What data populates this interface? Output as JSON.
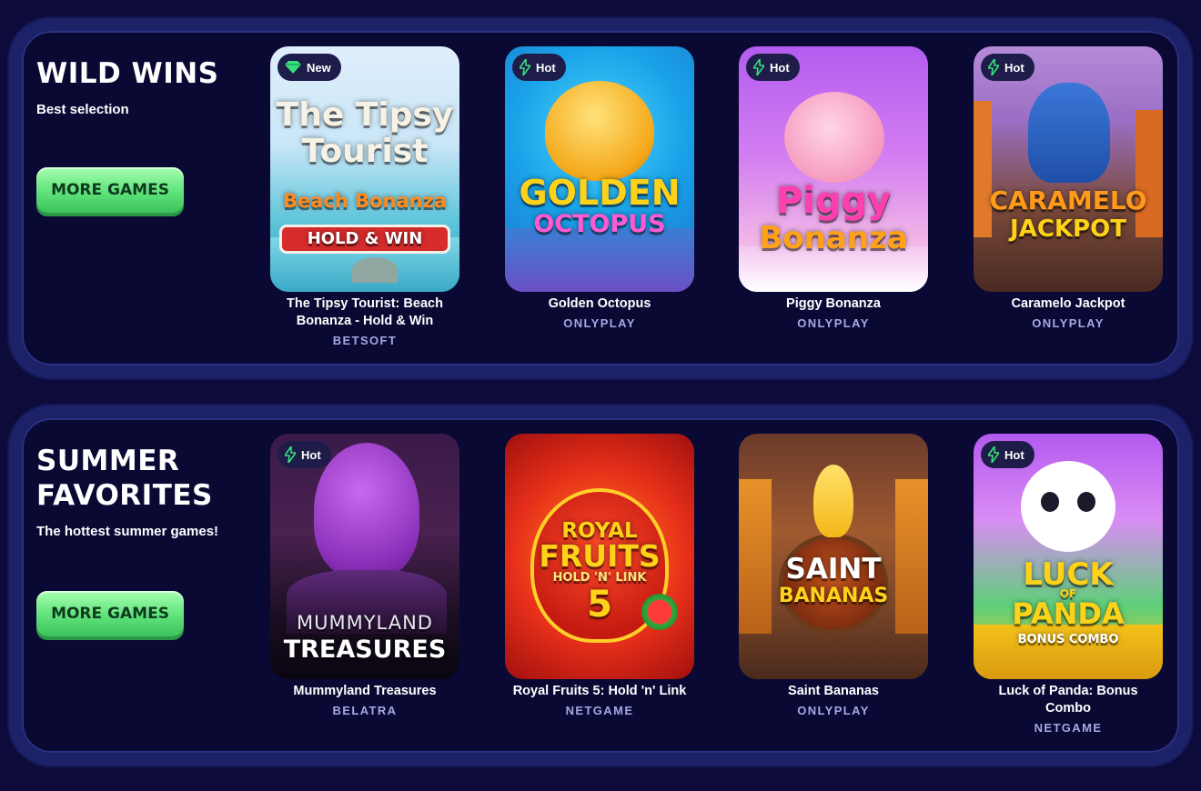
{
  "sections": [
    {
      "title": "WILD WINS",
      "subtitle": "Best selection",
      "button": "MORE GAMES",
      "games": [
        {
          "badge": "New",
          "badge_icon": "diamond-icon",
          "art_lines": [
            "The Tipsy",
            "Tourist",
            "Beach Bonanza",
            "HOLD & WIN"
          ],
          "name": "The Tipsy Tourist: Beach Bonanza - Hold & Win",
          "provider": "BETSOFT"
        },
        {
          "badge": "Hot",
          "badge_icon": "lightning-icon",
          "art_lines": [
            "GOLDEN",
            "OCTOPUS"
          ],
          "name": "Golden Octopus",
          "provider": "ONLYPLAY"
        },
        {
          "badge": "Hot",
          "badge_icon": "lightning-icon",
          "art_lines": [
            "Piggy",
            "Bonanza"
          ],
          "name": "Piggy Bonanza",
          "provider": "ONLYPLAY"
        },
        {
          "badge": "Hot",
          "badge_icon": "lightning-icon",
          "art_lines": [
            "CARAMELO",
            "JACKPOT"
          ],
          "name": "Caramelo Jackpot",
          "provider": "ONLYPLAY"
        }
      ]
    },
    {
      "title": "SUMMER FAVORITES",
      "subtitle": "The hottest summer games!",
      "button": "MORE GAMES",
      "games": [
        {
          "badge": "Hot",
          "badge_icon": "lightning-icon",
          "art_lines": [
            "MUMMYLAND",
            "TREASURES"
          ],
          "name": "Mummyland Treasures",
          "provider": "BELATRA"
        },
        {
          "badge": "",
          "badge_icon": "",
          "art_lines": [
            "ROYAL",
            "FRUITS",
            "HOLD 'N' LINK",
            "5"
          ],
          "name": "Royal Fruits 5: Hold 'n' Link",
          "provider": "NETGAME"
        },
        {
          "badge": "",
          "badge_icon": "",
          "art_lines": [
            "SAINT",
            "BANANAS"
          ],
          "name": "Saint Bananas",
          "provider": "ONLYPLAY"
        },
        {
          "badge": "Hot",
          "badge_icon": "lightning-icon",
          "art_lines": [
            "LUCK",
            "OF",
            "PANDA",
            "BONUS COMBO"
          ],
          "name": "Luck of Panda: Bonus Combo",
          "provider": "NETGAME"
        }
      ]
    }
  ]
}
